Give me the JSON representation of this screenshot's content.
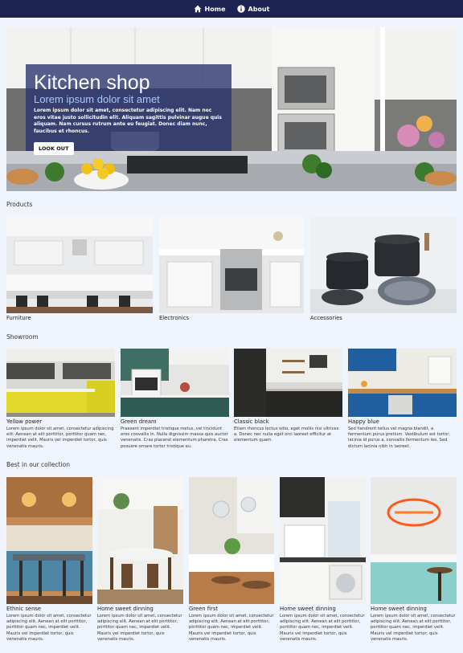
{
  "nav": {
    "home": "Home",
    "about": "About"
  },
  "hero": {
    "title": "Kitchen shop",
    "subtitle": "Lorem ipsum dolor sit amet",
    "text": "Lorem ipsum dolor sit amet, consectetur adipiscing elit. Nam nec eros vitae justo sollicitudin elit. Aliquam sagittis pulvinar augue quis aliquam. Nam cursus rutrum ante eu feugiat. Donec diam nunc, faucibus et rhoncus.",
    "button": "LOOK OUT"
  },
  "products": {
    "title": "Products",
    "items": [
      "Furniture",
      "Electronics",
      "Accessories"
    ]
  },
  "showroom": {
    "title": "Showroom",
    "items": [
      {
        "name": "Yellow power",
        "desc": "Lorem ipsum dolor sit amet, consectetur adipiscing elit. Aenean at elit porttitor, porttitor quam nec, imperdiet velit. Mauris vel imperdiet tortor, quis venenatis mauris."
      },
      {
        "name": "Green dream",
        "desc": "Praesent imperdiet tristique metus, vel tincidunt eros convallis in. Nulla dignissim massa quis auctor venenatis. Cras placerat elementum pharetra. Cras posuere ornare tortor tristique eu."
      },
      {
        "name": "Classic black",
        "desc": "Etiam rhoncus lectus odio, eget mollis nisi ultrices a. Donec nec nulla eget orci laoreet efficitur at elementum quam."
      },
      {
        "name": "Happy blue",
        "desc": "Sed hendrerit tellus vel magna blandit, a fermentum purus pretium. Vestibulum est tortor, lacinia id purus a, convallis fermentum leo. Sed dictum lacinia nibh in laoreet."
      }
    ]
  },
  "collection": {
    "title": "Best in our collection",
    "items": [
      {
        "name": "Ethnic sense",
        "desc": "Lorem ipsum dolor sit amet, consectetur adipiscing elit. Aenean at elit porttitor, porttitor quam nec, imperdiet velit. Mauris vel imperdiet tortor, quis venenatis mauris."
      },
      {
        "name": "Home sweet dinning",
        "desc": "Lorem ipsum dolor sit amet, consectetur adipiscing elit. Aenean at elit porttitor, porttitor quam nec, imperdiet velit. Mauris vel imperdiet tortor, quis venenatis mauris."
      },
      {
        "name": "Green first",
        "desc": "Lorem ipsum dolor sit amet, consectetur adipiscing elit. Aenean at elit porttitor, porttitor quam nec, imperdiet velit. Mauris vel imperdiet tortor, quis venenatis mauris."
      },
      {
        "name": "Home sweet dinning",
        "desc": "Lorem ipsum dolor sit amet, consectetur adipiscing elit. Aenean at elit porttitor, porttitor quam nec, imperdiet velit. Mauris vel imperdiet tortor, quis venenatis mauris."
      },
      {
        "name": "Home sweet dinning",
        "desc": "Lorem ipsum dolor sit amet, consectetur adipiscing elit. Aenean at elit porttitor, porttitor quam nec, imperdiet velit. Mauris vel imperdiet tortor, quis venenatis mauris."
      }
    ]
  },
  "colors": {
    "navbar": "#1d2352",
    "page_bg": "#f0f5fd",
    "hero_overlay": "#28326e",
    "subtitle": "#a9c8ff"
  },
  "icons": {
    "home": "home-icon",
    "about": "info-icon"
  }
}
